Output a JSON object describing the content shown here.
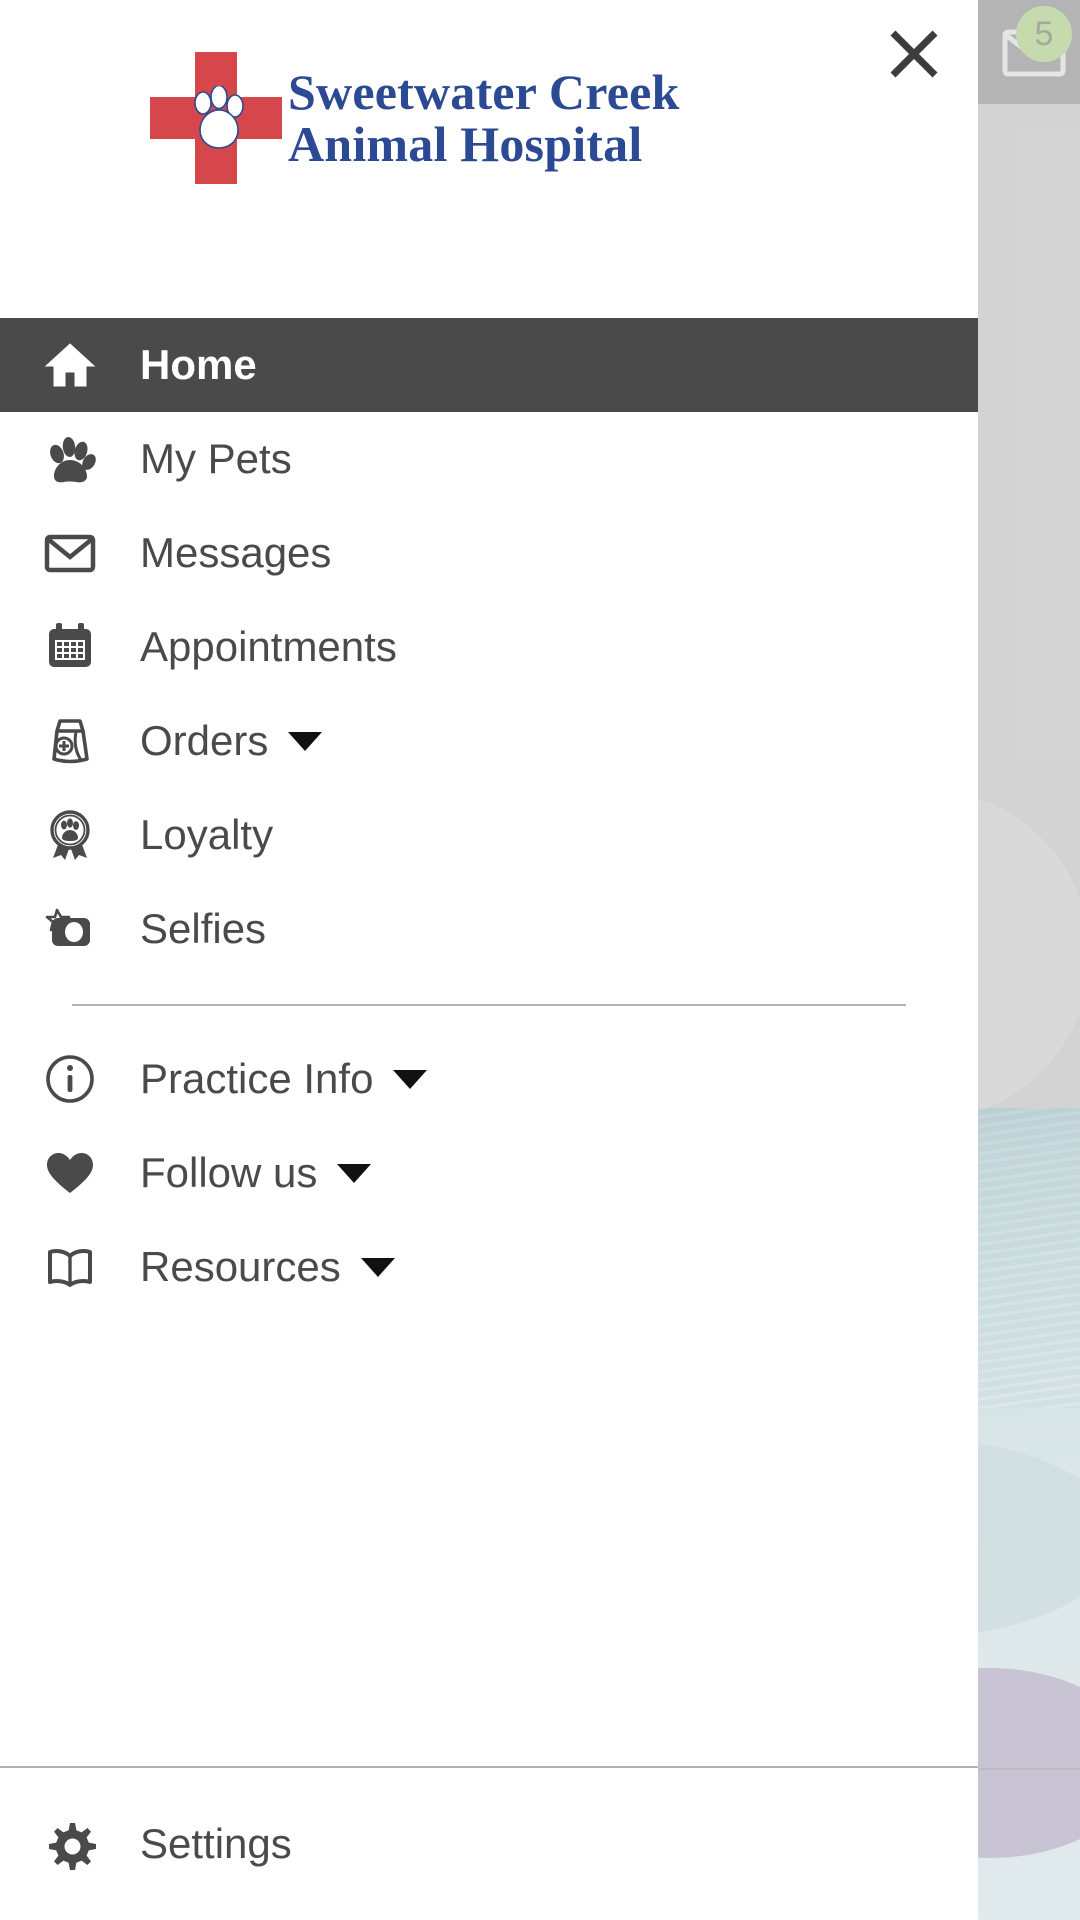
{
  "background": {
    "mail_icon": "mail-icon",
    "mail_badge_count": "5",
    "badge_color": "#a8c983",
    "topbar_color": "#8e8e8e"
  },
  "drawer": {
    "close_icon": "close-icon",
    "logo": {
      "icon": "red-cross-paw-logo",
      "line1": "Sweetwater Creek",
      "line2": "Animal Hospital",
      "text_color": "#2b4a93",
      "cross_color": "#d6474c"
    },
    "active_color": "#4a4a4a",
    "nav_primary": [
      {
        "label": "Home",
        "icon": "home-icon",
        "active": true,
        "caret": false
      },
      {
        "label": "My Pets",
        "icon": "paw-icon",
        "active": false,
        "caret": false
      },
      {
        "label": "Messages",
        "icon": "mail-icon",
        "active": false,
        "caret": false
      },
      {
        "label": "Appointments",
        "icon": "calendar-icon",
        "active": false,
        "caret": false
      },
      {
        "label": "Orders",
        "icon": "food-bag-icon",
        "active": false,
        "caret": true
      },
      {
        "label": "Loyalty",
        "icon": "award-paw-icon",
        "active": false,
        "caret": false
      },
      {
        "label": "Selfies",
        "icon": "camera-star-icon",
        "active": false,
        "caret": false
      }
    ],
    "nav_secondary": [
      {
        "label": "Practice Info",
        "icon": "info-icon",
        "active": false,
        "caret": true
      },
      {
        "label": "Follow us",
        "icon": "heart-icon",
        "active": false,
        "caret": true
      },
      {
        "label": "Resources",
        "icon": "book-icon",
        "active": false,
        "caret": true
      }
    ],
    "footer": {
      "settings": {
        "label": "Settings",
        "icon": "gear-icon"
      }
    }
  }
}
